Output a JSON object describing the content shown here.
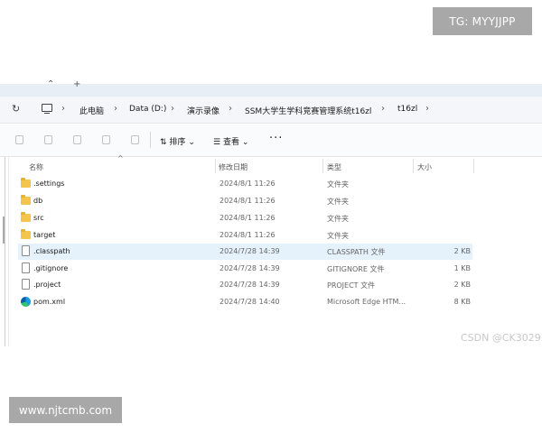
{
  "watermarks": {
    "top": "TG: MYYJJPP",
    "bottom": "www.njtcmb.com",
    "csdn": "CSDN @CK3029"
  },
  "tabs": {
    "close_glyph": "⌃",
    "new_tab_glyph": "+"
  },
  "address": {
    "refresh_icon": "refresh-icon",
    "separator": "›",
    "breadcrumbs": [
      "此电脑",
      "Data (D:)",
      "演示录像",
      "SSM大学生学科竞赛管理系统t16zl",
      "t16zl"
    ]
  },
  "toolbar": {
    "sort_label": "排序",
    "view_label": "查看",
    "more_label": "···",
    "dropdown_glyph": "⌄"
  },
  "columns": {
    "name": "名称",
    "date": "修改日期",
    "type": "类型",
    "size": "大小",
    "sort_indicator": "^"
  },
  "files": [
    {
      "name": ".settings",
      "date": "2024/8/1 11:26",
      "type": "文件夹",
      "size": "",
      "kind": "folder"
    },
    {
      "name": "db",
      "date": "2024/8/1 11:26",
      "type": "文件夹",
      "size": "",
      "kind": "folder"
    },
    {
      "name": "src",
      "date": "2024/8/1 11:26",
      "type": "文件夹",
      "size": "",
      "kind": "folder"
    },
    {
      "name": "target",
      "date": "2024/8/1 11:26",
      "type": "文件夹",
      "size": "",
      "kind": "folder"
    },
    {
      "name": ".classpath",
      "date": "2024/7/28 14:39",
      "type": "CLASSPATH 文件",
      "size": "2 KB",
      "kind": "file",
      "selected": true
    },
    {
      "name": ".gitignore",
      "date": "2024/7/28 14:39",
      "type": "GITIGNORE 文件",
      "size": "1 KB",
      "kind": "file"
    },
    {
      "name": ".project",
      "date": "2024/7/28 14:39",
      "type": "PROJECT 文件",
      "size": "2 KB",
      "kind": "file"
    },
    {
      "name": "pom.xml",
      "date": "2024/7/28 14:40",
      "type": "Microsoft Edge HTM...",
      "size": "8 KB",
      "kind": "edge"
    }
  ]
}
